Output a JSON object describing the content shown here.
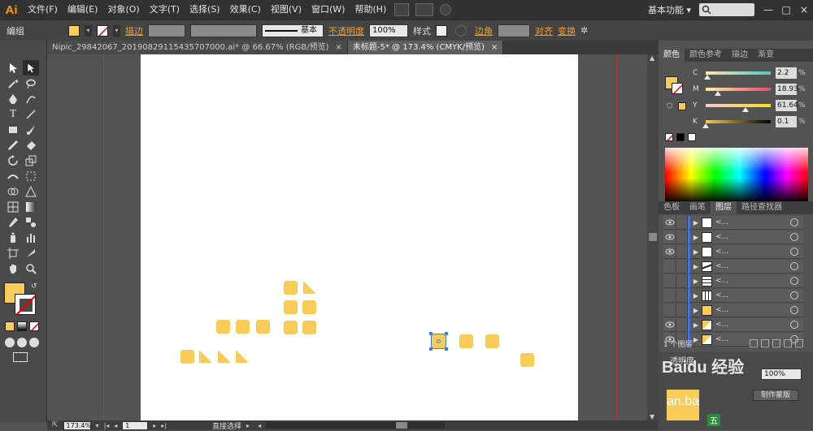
{
  "app": {
    "logo": "Ai",
    "menu": [
      "文件(F)",
      "编辑(E)",
      "对象(O)",
      "文字(T)",
      "选择(S)",
      "效果(C)",
      "视图(V)",
      "窗口(W)",
      "帮助(H)"
    ],
    "workspace": "基本功能",
    "workspace_caret": "▾",
    "window_controls": [
      "—",
      "□",
      "×"
    ]
  },
  "control_bar": {
    "mode": "编组",
    "stroke_label": "描边",
    "stroke_style": "基本",
    "opacity_label": "不透明度",
    "opacity_value": "100%",
    "style_label": "样式",
    "corner_label": "边角",
    "align_label": "对齐",
    "transform_label": "变换",
    "fill_color": "#f9cc57"
  },
  "tabs": [
    {
      "label": "Nipic_29842067_20190829115435707000.ai* @ 66.67% (RGB/预览)",
      "close": "×",
      "active": false
    },
    {
      "label": "未标题-5* @ 173.4% (CMYK/预览)",
      "close": "×",
      "active": true
    }
  ],
  "status_bar": {
    "zoom": "173.4%",
    "page": "1",
    "tool_status": "直接选择"
  },
  "color_panel": {
    "tabs": [
      "颜色",
      "颜色参考",
      "描边",
      "渐变"
    ],
    "channels": [
      {
        "label": "C",
        "value": "2.2",
        "unit": "%",
        "level": 0.022
      },
      {
        "label": "M",
        "value": "18.93",
        "unit": "%",
        "level": 0.189
      },
      {
        "label": "Y",
        "value": "61.64",
        "unit": "%",
        "level": 0.616
      },
      {
        "label": "K",
        "value": "0.1",
        "unit": "%",
        "level": 0.001
      }
    ]
  },
  "layers_panel": {
    "tabs": [
      "色板",
      "画笔",
      "图层",
      "路径查找器"
    ],
    "rows": [
      {
        "name": "<...",
        "visible": true,
        "thumb": "white"
      },
      {
        "name": "<...",
        "visible": true,
        "thumb": "white"
      },
      {
        "name": "<...",
        "visible": true,
        "thumb": "white"
      },
      {
        "name": "<...",
        "visible": false,
        "thumb": "slash"
      },
      {
        "name": "<...",
        "visible": false,
        "thumb": "lines"
      },
      {
        "name": "<...",
        "visible": false,
        "thumb": "bars"
      },
      {
        "name": "<...",
        "visible": false,
        "thumb": "yellow"
      },
      {
        "name": "<...",
        "visible": true,
        "thumb": "triangle"
      },
      {
        "name": "<...",
        "visible": true,
        "thumb": "triangle"
      }
    ],
    "footer": "1 个图层"
  },
  "lower_panel": {
    "tab": "透明度",
    "opacity": "100%",
    "make_mask": "制作蒙版"
  },
  "watermark": "Baidu 经验",
  "watermark_sub": "an.ba",
  "ime": "五"
}
